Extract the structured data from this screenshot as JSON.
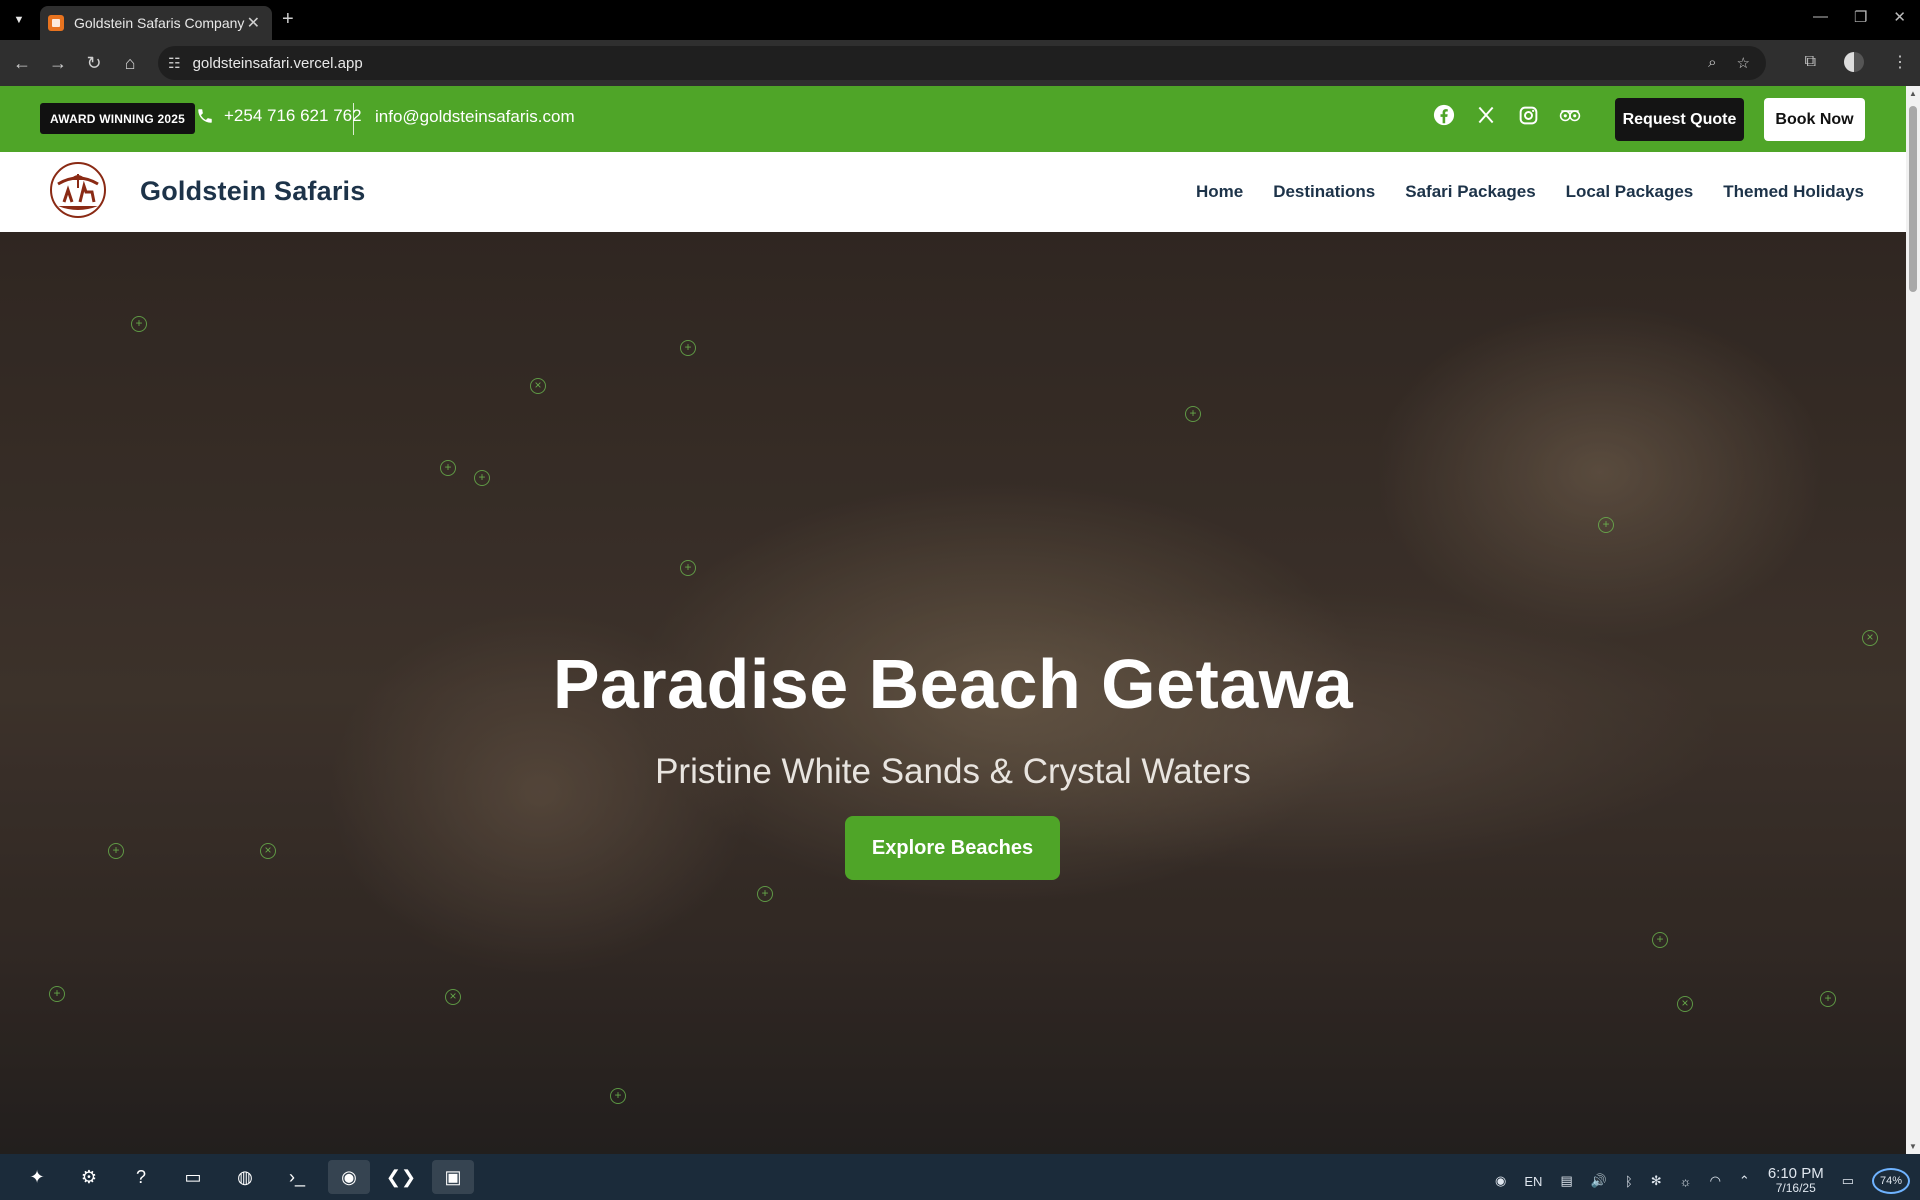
{
  "browser": {
    "tab_title": "Goldstein Safaris Company",
    "url": "goldsteinsafari.vercel.app"
  },
  "topbar": {
    "award": "AWARD WINNING 2025",
    "phone": "+254 716 621 762",
    "email": "info@goldsteinsafaris.com",
    "request_quote": "Request Quote",
    "book_now": "Book Now",
    "socials": [
      "facebook-icon",
      "x-icon",
      "instagram-icon",
      "tripadvisor-icon"
    ]
  },
  "nav": {
    "brand": "Goldstein Safaris",
    "items": [
      "Home",
      "Destinations",
      "Safari Packages",
      "Local Packages",
      "Themed Holidays"
    ]
  },
  "hero": {
    "title": "Paradise Beach Getawa",
    "subtitle": "Pristine White Sands & Crystal Waters",
    "cta": "Explore Beaches"
  },
  "taskbar": {
    "lang": "EN",
    "time": "6:10 PM",
    "date": "7/16/25",
    "battery": "74%"
  },
  "colors": {
    "brand_green": "#4fa528",
    "navy": "#1d3349",
    "dark_button": "#141414"
  }
}
